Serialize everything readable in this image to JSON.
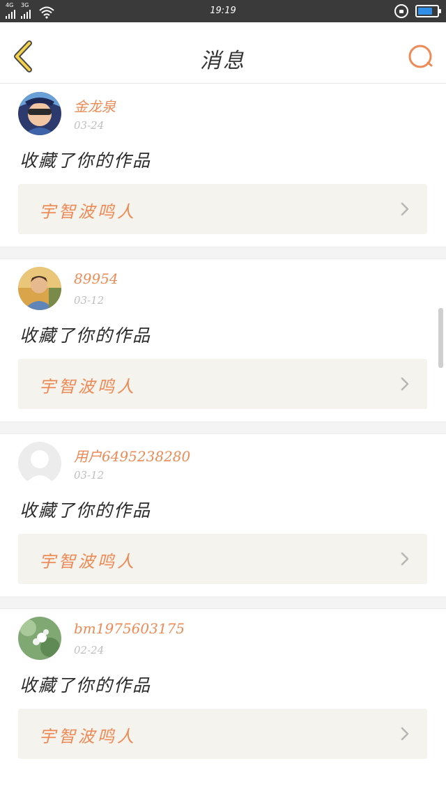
{
  "status_bar": {
    "network_1": "4G",
    "network_2": "3G",
    "time": "19:19",
    "battery_level": 0.75,
    "battery_color": "#2f8fe6"
  },
  "header": {
    "title": "消息",
    "back_icon": "chevron-left-icon",
    "search_icon": "search-icon",
    "accent_color": "#ee8a55"
  },
  "messages": [
    {
      "username": "金龙泉",
      "date": "03-24",
      "action": "收藏了你的作品",
      "work_title": "宇智波鸣人",
      "avatar": "cartoon-avatar"
    },
    {
      "username": "89954",
      "date": "03-12",
      "action": "收藏了你的作品",
      "work_title": "宇智波鸣人",
      "avatar": "photo-avatar"
    },
    {
      "username": "用户6495238280",
      "date": "03-12",
      "action": "收藏了你的作品",
      "work_title": "宇智波鸣人",
      "avatar": "default-avatar"
    },
    {
      "username": "bm1975603175",
      "date": "02-24",
      "action": "收藏了你的作品",
      "work_title": "宇智波鸣人",
      "avatar": "flower-avatar"
    }
  ]
}
